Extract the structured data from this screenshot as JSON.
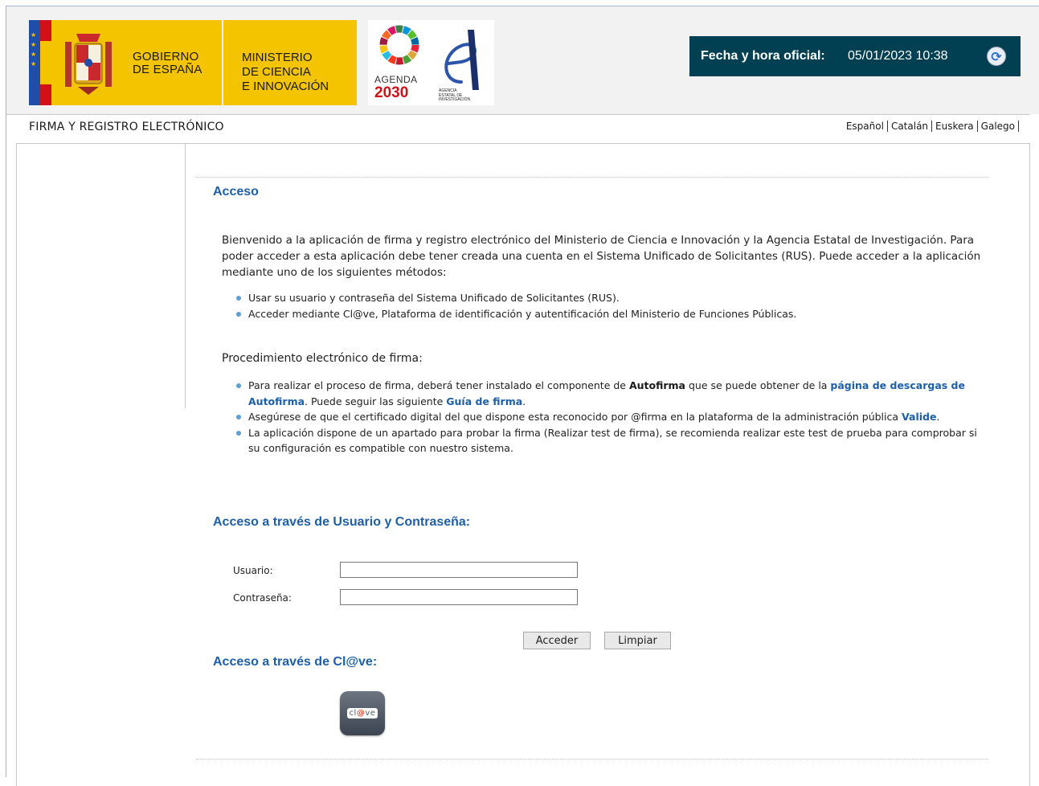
{
  "header": {
    "gov_line1": "GOBIERNO",
    "gov_line2": "DE ESPAÑA",
    "ministry_line1": "MINISTERIO",
    "ministry_line2": "DE CIENCIA",
    "ministry_line3": "E INNOVACIÓN",
    "agenda_label": "AGENDA",
    "agenda_year": "2030",
    "aei_line1": "AGENCIA",
    "aei_line2": "ESTATAL DE",
    "aei_line3": "INVESTIGACIÓN",
    "date_label": "Fecha y hora oficial:",
    "date_value": "05/01/2023 10:38",
    "refresh_icon": "refresh-icon"
  },
  "app_title": "FIRMA Y REGISTRO ELECTRÓNICO",
  "languages": [
    "Español",
    "Catalán",
    "Euskera",
    "Galego"
  ],
  "main": {
    "heading": "Acceso",
    "intro": "Bienvenido a la aplicación de firma y registro electrónico del Ministerio de Ciencia e Innovación y la Agencia Estatal de Investigación. Para poder acceder a esta aplicación debe tener creada una cuenta en el Sistema Unificado de Solicitantes (RUS). Puede acceder a la aplicación mediante uno de los siguientes métodos:",
    "methods": [
      "Usar su usuario y contraseña del Sistema Unificado de Solicitantes (RUS).",
      "Acceder mediante Cl@ve, Plataforma de identificación y autentificación del Ministerio de Funciones Públicas."
    ],
    "procedure_heading": "Procedimiento electrónico de firma:",
    "procedure": {
      "item1_a": "Para realizar el proceso de firma, deberá tener instalado el componente de ",
      "item1_bold": "Autofirma",
      "item1_b": " que se puede obtener de la ",
      "item1_link": "página de descargas de Autofirma",
      "item1_c": ". Puede seguir las siguiente ",
      "item1_link2": "Guía de firma",
      "item1_d": ".",
      "item2_a": "Asegúrese de que el certificado digital del que dispone esta reconocido por @firma en la plataforma de la administración pública ",
      "item2_link": "Valide",
      "item2_b": ".",
      "item3": "La aplicación dispone de un apartado para probar la firma (Realizar test de firma), se recomienda realizar este test de prueba para comprobar si su configuración es compatible con nuestro sistema."
    }
  },
  "login": {
    "heading": "Acceso a través de Usuario y Contraseña:",
    "user_label": "Usuario:",
    "user_value": "",
    "password_label": "Contraseña:",
    "password_value": "",
    "submit_label": "Acceder",
    "clear_label": "Limpiar"
  },
  "clave": {
    "heading": "Acceso a través de Cl@ve:",
    "logo_text_a": "cl",
    "logo_text_b": "@",
    "logo_text_c": "ve"
  },
  "colors": {
    "accent": "#1d5fa8",
    "date_bg": "#004052",
    "gov_yellow": "#f4c400"
  }
}
